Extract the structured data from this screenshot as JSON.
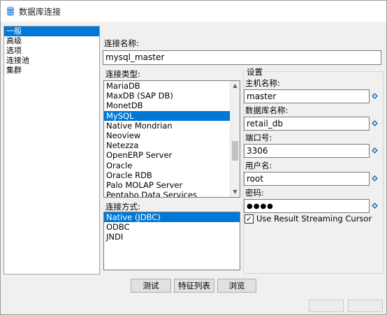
{
  "window": {
    "title": "数据库连接",
    "icon": "database-icon"
  },
  "nav": {
    "items": [
      "一般",
      "高级",
      "选项",
      "连接池",
      "集群"
    ],
    "selected_index": 0
  },
  "connection_name": {
    "label": "连接名称:",
    "value": "mysql_master"
  },
  "connection_type": {
    "label": "连接类型:",
    "items": [
      "MariaDB",
      "MaxDB (SAP DB)",
      "MonetDB",
      "MySQL",
      "Native Mondrian",
      "Neoview",
      "Netezza",
      "OpenERP Server",
      "Oracle",
      "Oracle RDB",
      "Palo MOLAP Server",
      "Pentaho Data Services"
    ],
    "selected": "MySQL"
  },
  "access_method": {
    "label": "连接方式:",
    "items": [
      "Native (JDBC)",
      "ODBC",
      "JNDI"
    ],
    "selected": "Native (JDBC)"
  },
  "settings": {
    "title": "设置",
    "host": {
      "label": "主机名称:",
      "value": "master"
    },
    "database": {
      "label": "数据库名称:",
      "value": "retail_db"
    },
    "port": {
      "label": "端口号:",
      "value": "3306"
    },
    "username": {
      "label": "用户名:",
      "value": "root"
    },
    "password": {
      "label": "密码:",
      "value": "●●●●"
    },
    "streaming_cursor": {
      "label": "Use Result Streaming Cursor",
      "checked": true
    },
    "variable_icon": "variable-diamond-icon"
  },
  "buttons": {
    "test": "测试",
    "feature_list": "特征列表",
    "explore": "浏览"
  },
  "colors": {
    "selection": "#0078d7",
    "variable_icon": "#3b7fbf",
    "title_icon": "#4a90d9"
  }
}
